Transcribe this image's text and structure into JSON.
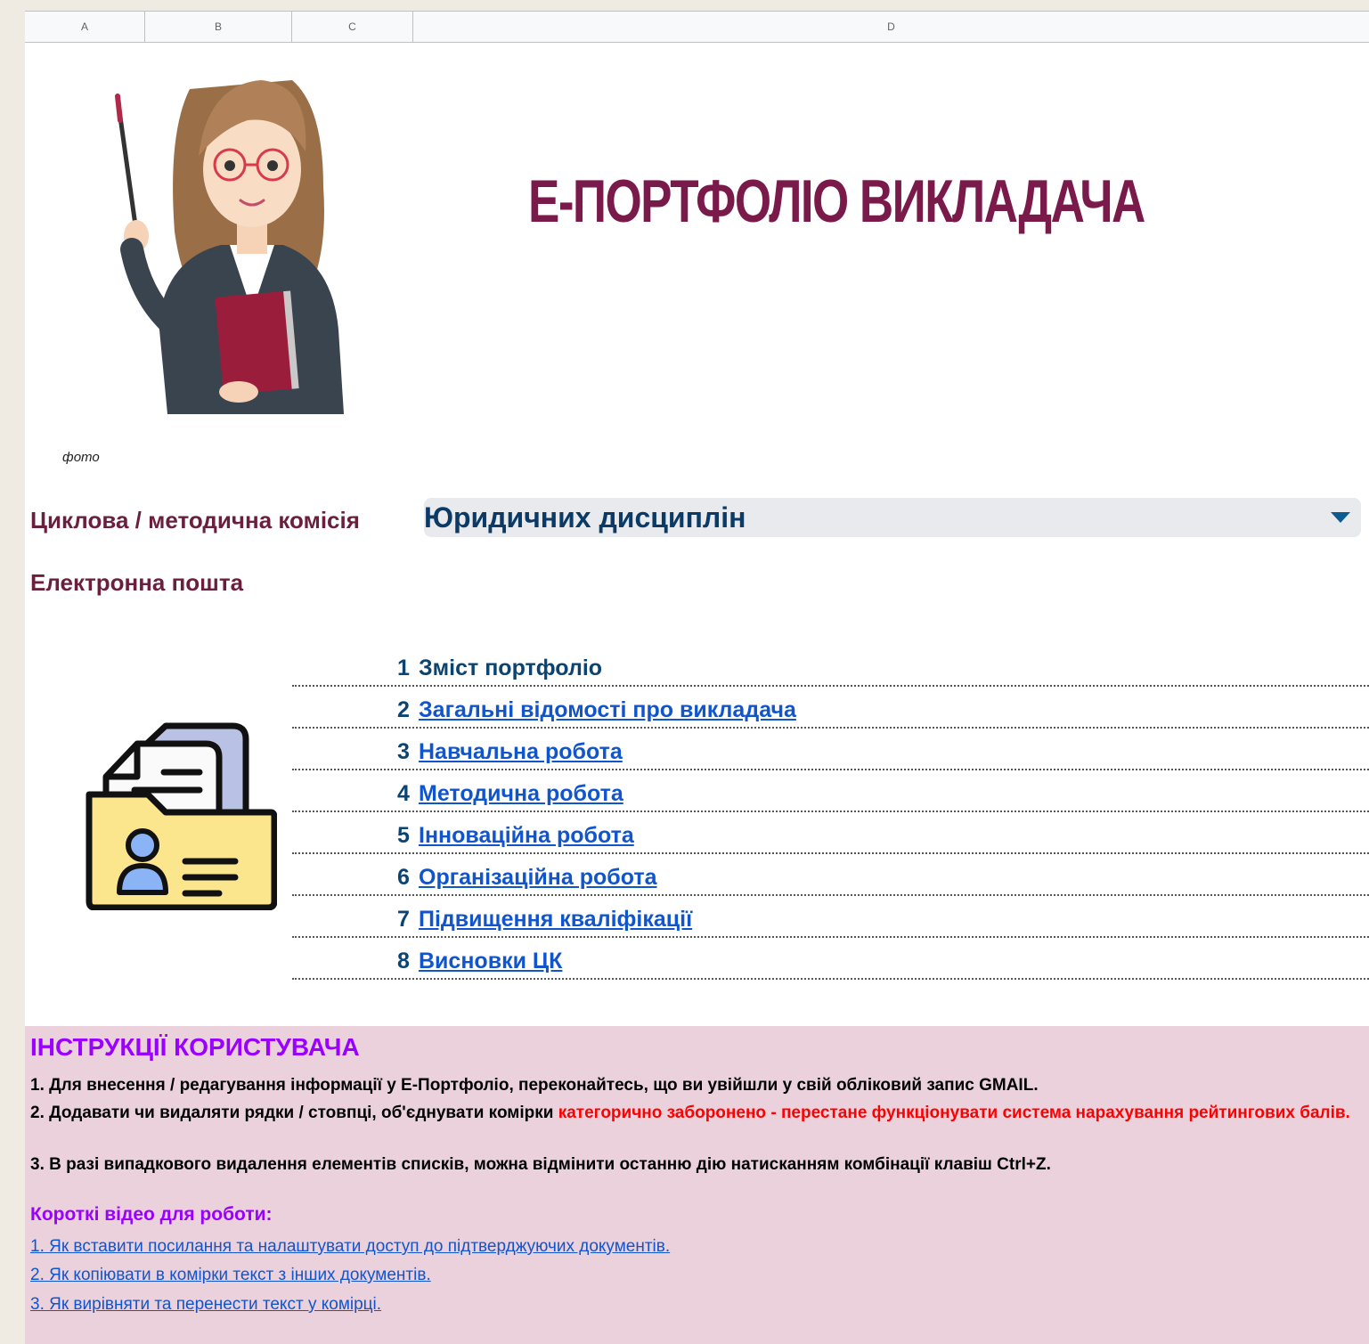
{
  "columns": [
    "A",
    "B",
    "C",
    "D"
  ],
  "title": "Е-ПОРТФОЛІО ВИКЛАДАЧА",
  "photo_caption": "фото",
  "commission": {
    "label": "Циклова / методична комісія",
    "value": "Юридичних дисциплін"
  },
  "email": {
    "label": "Електронна пошта",
    "value": ""
  },
  "toc": [
    {
      "num": "1",
      "text": "Зміст портфоліо",
      "link": false
    },
    {
      "num": "2",
      "text": "Загальні відомості про викладача",
      "link": true
    },
    {
      "num": "3",
      "text": "Навчальна робота",
      "link": true
    },
    {
      "num": "4",
      "text": "Методична робота",
      "link": true
    },
    {
      "num": "5",
      "text": "Інноваційна робота",
      "link": true
    },
    {
      "num": "6",
      "text": "Організаційна робота",
      "link": true
    },
    {
      "num": "7",
      "text": "Підвищення кваліфікації",
      "link": true
    },
    {
      "num": "8",
      "text": "Висновки ЦК",
      "link": true
    }
  ],
  "instructions": {
    "title": "ІНСТРУКЦІЇ КОРИСТУВАЧА",
    "line1": "1. Для внесення / редагування інформації у Е-Портфоліо, переконайтесь, що ви увійшли у свій обліковий запис GMAIL.",
    "line2_start": "2. Додавати чи видаляти рядки / стовпці, об'єднувати комірки ",
    "line2_red1": "категорично заборонено",
    "line2_mid": " - ",
    "line2_red2": "перестане функціонувати система нарахування рейтингових балів.",
    "line3": "3. В разі випадкового видалення елементів списків, можна відмінити останню дію натисканням комбінації клавіш Ctrl+Z."
  },
  "videos": {
    "title": "Короткі відео для роботи:",
    "links": [
      "1. Як вставити посилання та налаштувати доступ до підтверджуючих документів.",
      "2. Як копіювати в комірки текст з інших документів.",
      "3. Як вирівняти та перенести текст у комірці."
    ]
  },
  "colors": {
    "title": "#7a1a4a",
    "label": "#6b1f3f",
    "link": "#1155cc",
    "instructions_bg": "#ead1dc",
    "instructions_title": "#9900ff",
    "warning": "#ff0000"
  }
}
